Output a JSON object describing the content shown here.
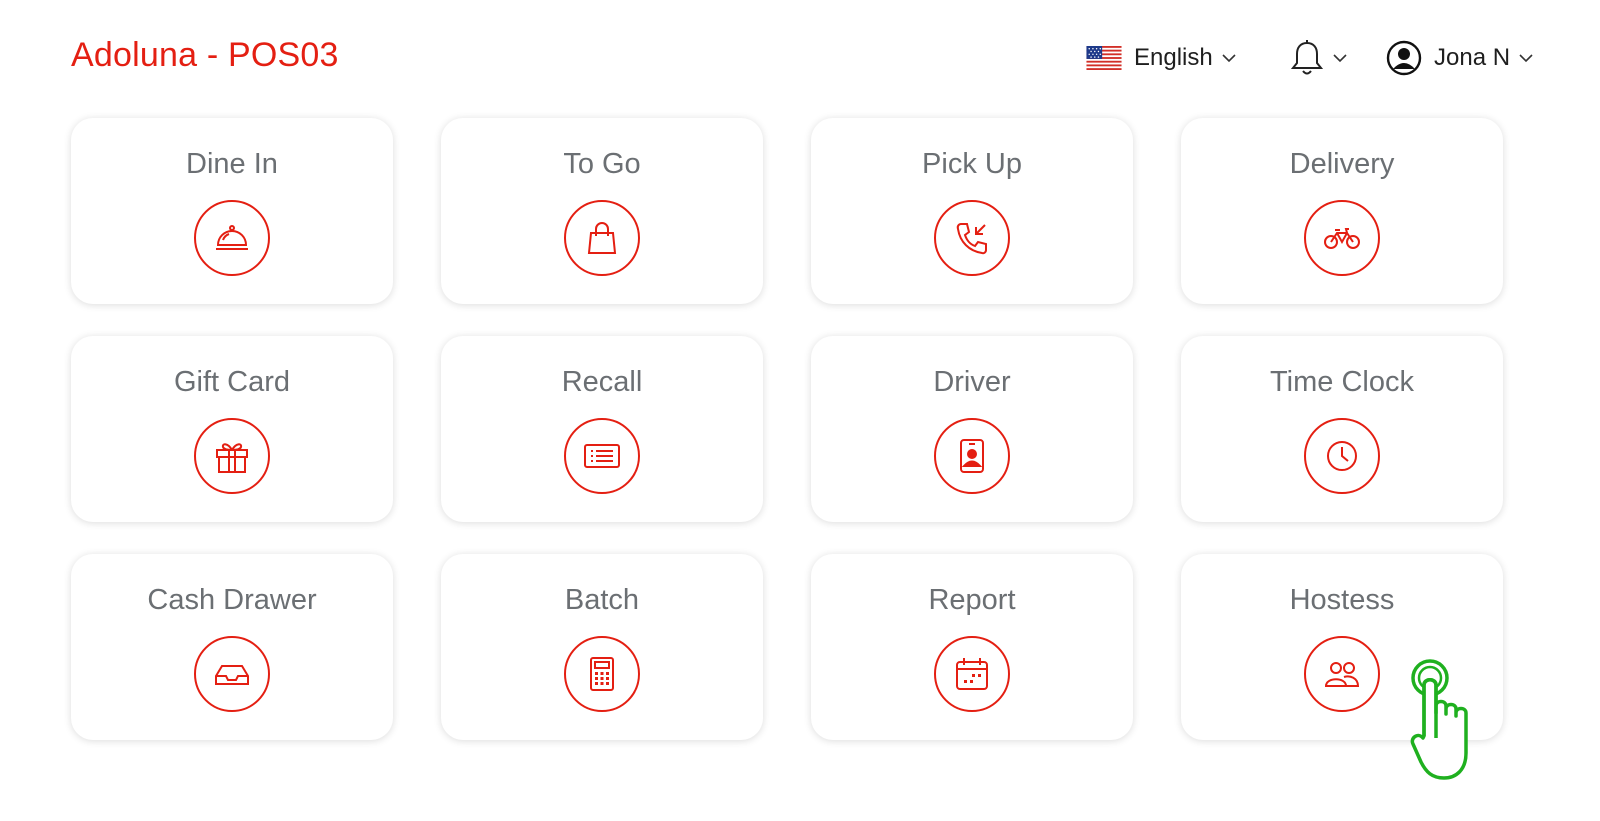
{
  "header": {
    "title": "Adoluna - POS03",
    "language": "English",
    "language_flag": "us-flag",
    "user_name": "Jona N"
  },
  "colors": {
    "accent": "#e41f12",
    "tile_text": "#6b6f73",
    "touch": "#1fb01f"
  },
  "tiles": [
    {
      "label": "Dine In",
      "icon": "cloche-icon"
    },
    {
      "label": "To Go",
      "icon": "shopping-bag-icon"
    },
    {
      "label": "Pick Up",
      "icon": "incoming-call-icon"
    },
    {
      "label": "Delivery",
      "icon": "bicycle-icon"
    },
    {
      "label": "Gift Card",
      "icon": "gift-icon"
    },
    {
      "label": "Recall",
      "icon": "receipt-list-icon"
    },
    {
      "label": "Driver",
      "icon": "id-badge-icon"
    },
    {
      "label": "Time Clock",
      "icon": "clock-icon"
    },
    {
      "label": "Cash Drawer",
      "icon": "drawer-tray-icon"
    },
    {
      "label": "Batch",
      "icon": "calculator-icon"
    },
    {
      "label": "Report",
      "icon": "calendar-icon"
    },
    {
      "label": "Hostess",
      "icon": "users-icon"
    }
  ]
}
